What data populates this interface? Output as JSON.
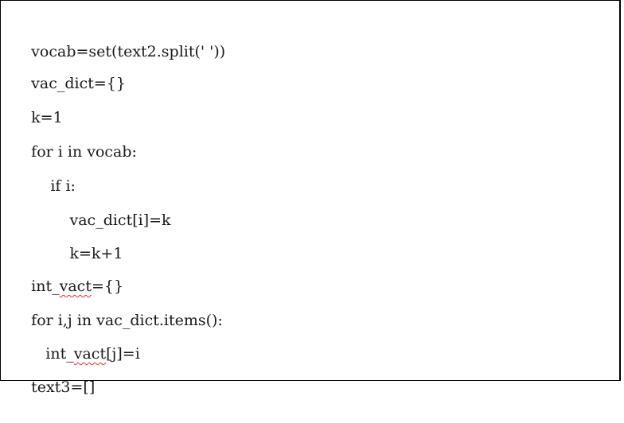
{
  "code": {
    "lines": [
      {
        "segments": [
          "vocab=set(text2.split(' '))"
        ]
      },
      {
        "segments": [
          "vac_dict={}"
        ]
      },
      {
        "segments": [
          "k=1"
        ]
      },
      {
        "segments": [
          "for i in vocab:"
        ]
      },
      {
        "segments": [
          "    if i:"
        ]
      },
      {
        "segments": [
          "        vac_dict[i]=k"
        ]
      },
      {
        "segments": [
          "        k=k+1"
        ]
      },
      {
        "segments": [
          "int_",
          "vact",
          "={}"
        ],
        "flagged_segment": 1
      },
      {
        "segments": [
          "for i,j in vac_dict.items():"
        ]
      },
      {
        "segments": [
          "   int_",
          "vact",
          "[j]=i"
        ],
        "flagged_segment": 1
      },
      {
        "segments": [
          "text3=[]"
        ]
      }
    ],
    "flag_color": "#e03030",
    "text_color": "#1a1a1a",
    "border_color": "#000000"
  }
}
